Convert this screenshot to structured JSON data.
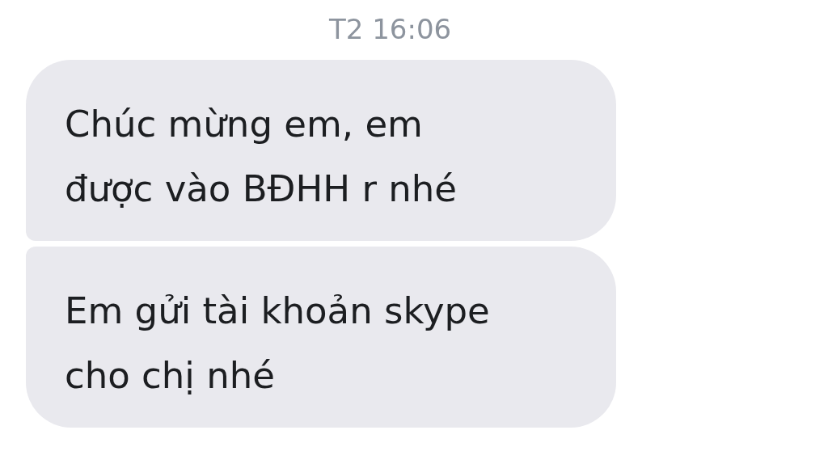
{
  "timestamp": "T2 16:06",
  "messages": [
    {
      "lines": [
        "Chúc mừng em, em",
        "được vào BĐHH r nhé"
      ]
    },
    {
      "lines": [
        "Em gửi tài khoản skype",
        "cho chị nhé"
      ]
    }
  ]
}
